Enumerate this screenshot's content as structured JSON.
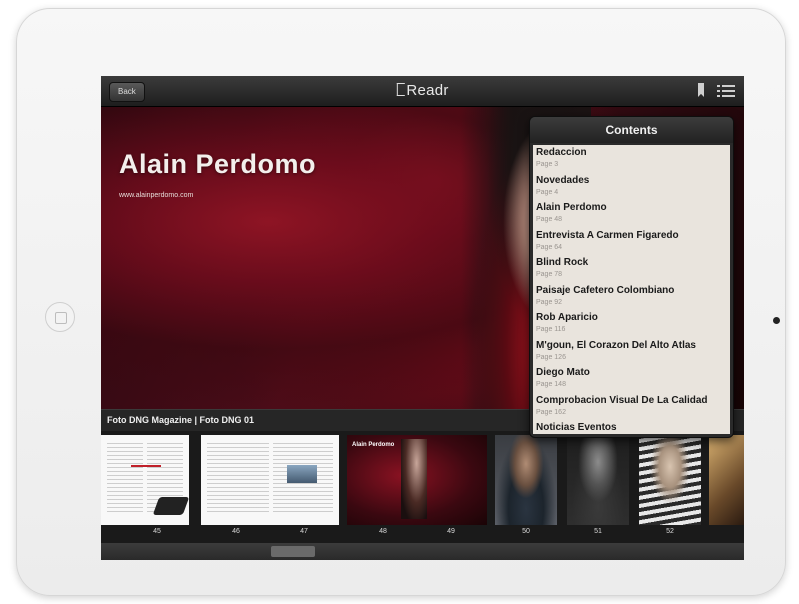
{
  "topbar": {
    "back_label": "Back",
    "app_name": "Readr"
  },
  "cover": {
    "title": "Alain Perdomo",
    "url": "www.alainperdomo.com"
  },
  "contents": {
    "header": "Contents",
    "items": [
      {
        "title": "Redaccion",
        "page": "Page 3"
      },
      {
        "title": "Novedades",
        "page": "Page 4"
      },
      {
        "title": "Alain Perdomo",
        "page": "Page 48"
      },
      {
        "title": "Entrevista A Carmen Figaredo",
        "page": "Page 64"
      },
      {
        "title": "Blind Rock",
        "page": "Page 78"
      },
      {
        "title": "Paisaje Cafetero Colombiano",
        "page": "Page 92"
      },
      {
        "title": "Rob Aparicio",
        "page": "Page 116"
      },
      {
        "title": "M'goun, El Corazon Del Alto Atlas",
        "page": "Page 126"
      },
      {
        "title": "Diego Mato",
        "page": "Page 148"
      },
      {
        "title": "Comprobacion Visual De La Calidad",
        "page": "Page 162"
      },
      {
        "title": "Noticias Eventos",
        "page": ""
      }
    ]
  },
  "caption": "Foto DNG Magazine | Foto DNG 01",
  "thumbnails": {
    "labels": [
      "45",
      "46",
      "47",
      "48",
      "49",
      "50",
      "51",
      "52"
    ],
    "cover_title": "Alain Perdomo"
  },
  "scrubber": {
    "position_fraction": 0.3
  },
  "icons": {
    "bookmark": "bookmark-icon",
    "contents": "list-icon"
  }
}
